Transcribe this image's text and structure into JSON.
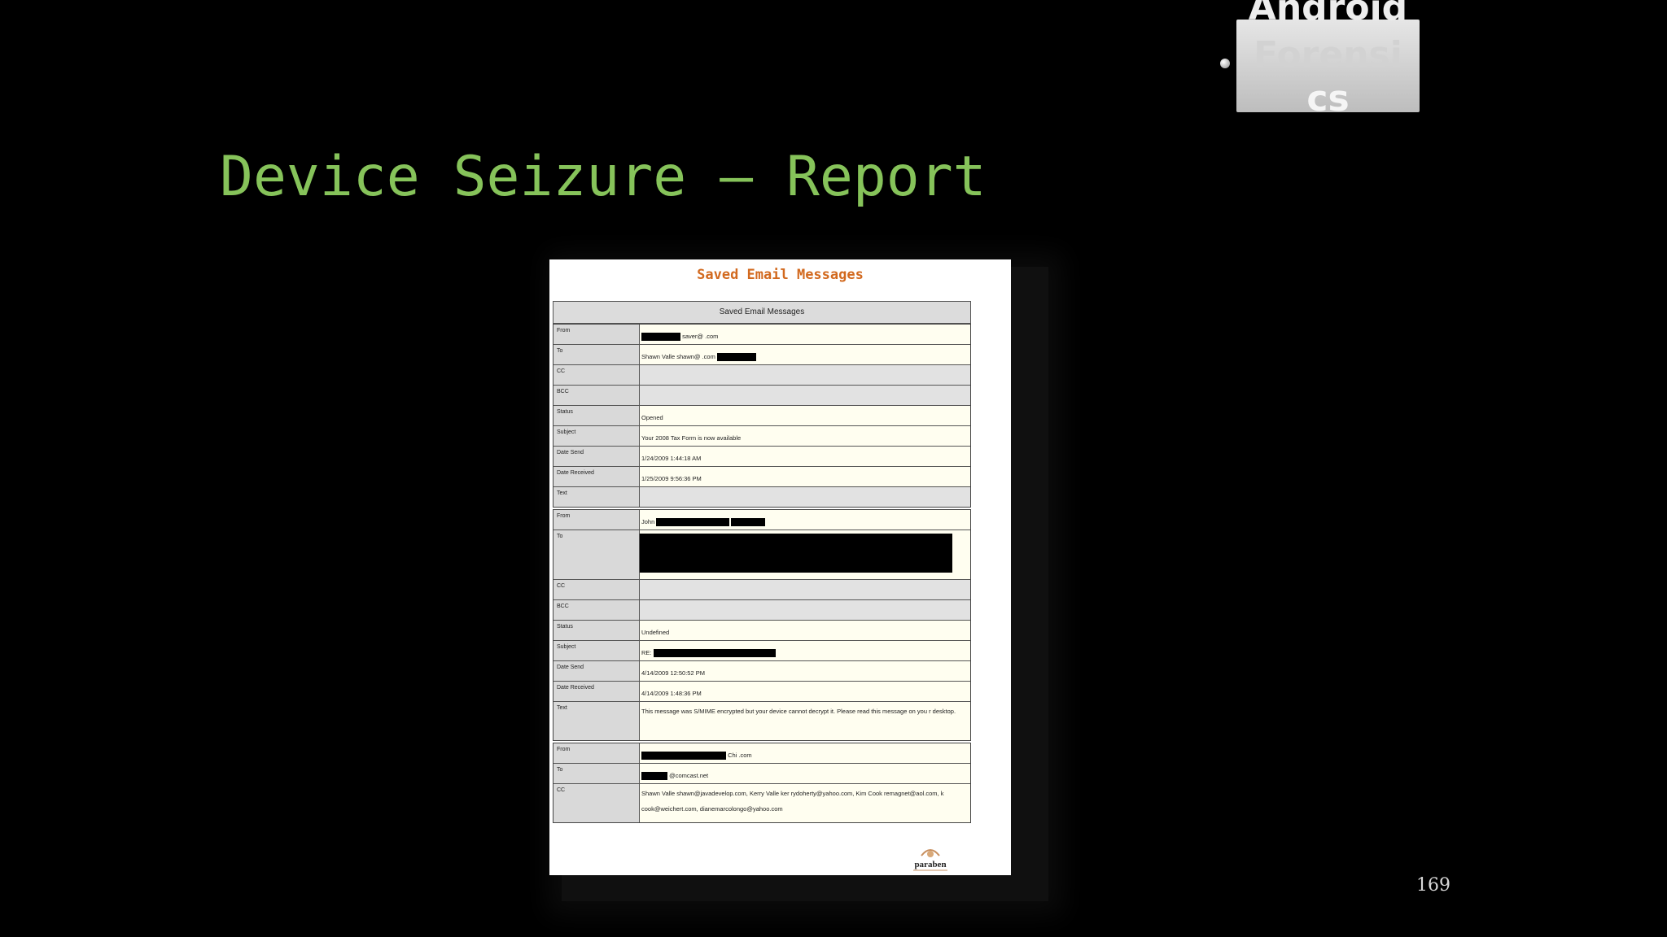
{
  "corner_tag": {
    "line1": "Android",
    "line2": "Forensi",
    "line3": "cs"
  },
  "slide": {
    "title": "Device Seizure – Report",
    "page_number": "169"
  },
  "report": {
    "heading": "Saved Email Messages",
    "table_header": "Saved Email Messages",
    "emails": [
      {
        "rows": [
          {
            "label": "From",
            "value": "saver@ .com"
          },
          {
            "label": "To",
            "value": "Shawn Valle shawn@ .com"
          },
          {
            "label": "CC",
            "value": ""
          },
          {
            "label": "BCC",
            "value": ""
          },
          {
            "label": "Status",
            "value": "Opened"
          },
          {
            "label": "Subject",
            "value": "Your 2008 Tax Form is now available"
          },
          {
            "label": "Date Send",
            "value": "1/24/2009 1:44:18 AM"
          },
          {
            "label": "Date Received",
            "value": "1/25/2009 9:56:36 PM"
          },
          {
            "label": "Text",
            "value": ""
          }
        ]
      },
      {
        "rows": [
          {
            "label": "From",
            "value": "John"
          },
          {
            "label": "To",
            "value": ""
          },
          {
            "label": "CC",
            "value": ""
          },
          {
            "label": "BCC",
            "value": ""
          },
          {
            "label": "Status",
            "value": "Undefined"
          },
          {
            "label": "Subject",
            "value": "RE:"
          },
          {
            "label": "Date Send",
            "value": "4/14/2009 12:50:52 PM"
          },
          {
            "label": "Date Received",
            "value": "4/14/2009 1:48:36 PM"
          },
          {
            "label": "Text",
            "value": "This message was S/MIME encrypted but your device cannot decrypt it. Please read this message on you r desktop."
          }
        ]
      },
      {
        "rows": [
          {
            "label": "From",
            "value": "Chi .com"
          },
          {
            "label": "To",
            "value": "@comcast.net"
          },
          {
            "label": "CC",
            "value": "Shawn Valle shawn@javadevelop.com, Kerry Valle ker rydoherty@yahoo.com, Kim Cook remagnet@aol.com, k cook@weichert.com, dianemarcolongo@yahoo.com"
          }
        ]
      }
    ],
    "logo_text": "paraben"
  }
}
